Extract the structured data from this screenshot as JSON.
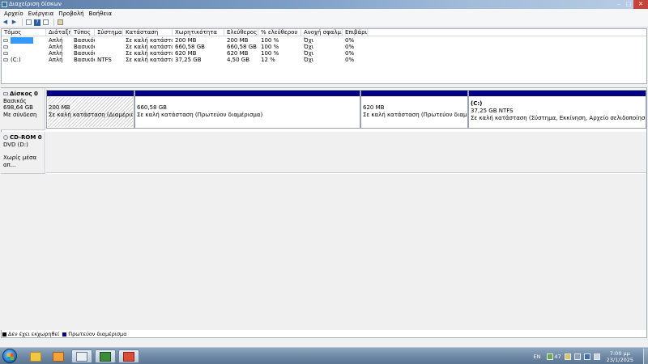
{
  "window": {
    "title": "Διαχείριση δίσκων"
  },
  "menu": [
    "Αρχείο",
    "Ενέργεια",
    "Προβολή",
    "Βοήθεια"
  ],
  "toolbar_icons": [
    "back-arrow-icon",
    "forward-arrow-icon",
    "volume-list-icon",
    "help-icon",
    "properties-icon",
    "view-icon"
  ],
  "volumes": {
    "columns": [
      "Τόμος",
      "Διάταξη",
      "Τύπος",
      "Σύστημα ...",
      "Κατάσταση",
      "Χωρητικότητα",
      "Ελεύθερος ...",
      "% ελεύθερου",
      "Ανοχή σφαλμ...",
      "Επιβάρυ..."
    ],
    "rows": [
      [
        "",
        "Απλή",
        "Βασικός",
        "",
        "Σε καλή κατάσταση",
        "200 MB",
        "200 MB",
        "100 %",
        "Όχι",
        "0%"
      ],
      [
        "",
        "Απλή",
        "Βασικός",
        "",
        "Σε καλή κατάσταση",
        "660,58 GB",
        "660,58 GB",
        "100 %",
        "Όχι",
        "0%"
      ],
      [
        "",
        "Απλή",
        "Βασικός",
        "",
        "Σε καλή κατάσταση",
        "620 MB",
        "620 MB",
        "100 %",
        "Όχι",
        "0%"
      ],
      [
        "(C:)",
        "Απλή",
        "Βασικός",
        "NTFS",
        "Σε καλή κατάσταση",
        "37,25 GB",
        "4,50 GB",
        "12 %",
        "Όχι",
        "0%"
      ]
    ]
  },
  "disk0": {
    "name": "Δίσκος 0",
    "type": "Βασικός",
    "size": "698,64 GB",
    "status": "Με σύνδεση",
    "partitions": [
      {
        "name": "",
        "size": "200 MB",
        "status": "Σε καλή κατάσταση (Διαμέρισμα προ"
      },
      {
        "name": "",
        "size": "660,58 GB",
        "status": "Σε καλή κατάσταση (Πρωτεύον διαμέρισμα)"
      },
      {
        "name": "",
        "size": "620 MB",
        "status": "Σε καλή κατάσταση (Πρωτεύον διαμέρισμα)"
      },
      {
        "name": "(C:)",
        "size": "37,25 GB NTFS",
        "status": "Σε καλή κατάσταση (Σύστημα, Εκκίνηση, Αρχείο σελιδοποίησης, Ενεργό, Απ"
      }
    ]
  },
  "cdrom0": {
    "name": "CD-ROM 0",
    "drive": "DVD (D:)",
    "status": "Χωρίς μέσα απ..."
  },
  "legend": {
    "unallocated": "Δεν έχει εκχωρηθεί",
    "primary": "Πρωτεύον διαμέρισμα",
    "colors": {
      "unallocated": "#000000",
      "primary": "#000080"
    }
  },
  "taskbar": {
    "apps": [
      "explorer-icon",
      "media-player-icon",
      "calculator-icon",
      "computer-management-icon",
      "disk-management-icon"
    ],
    "language": "EN",
    "tray_badge": "47",
    "time": "7:00 μμ",
    "date": "23/1/2025"
  }
}
